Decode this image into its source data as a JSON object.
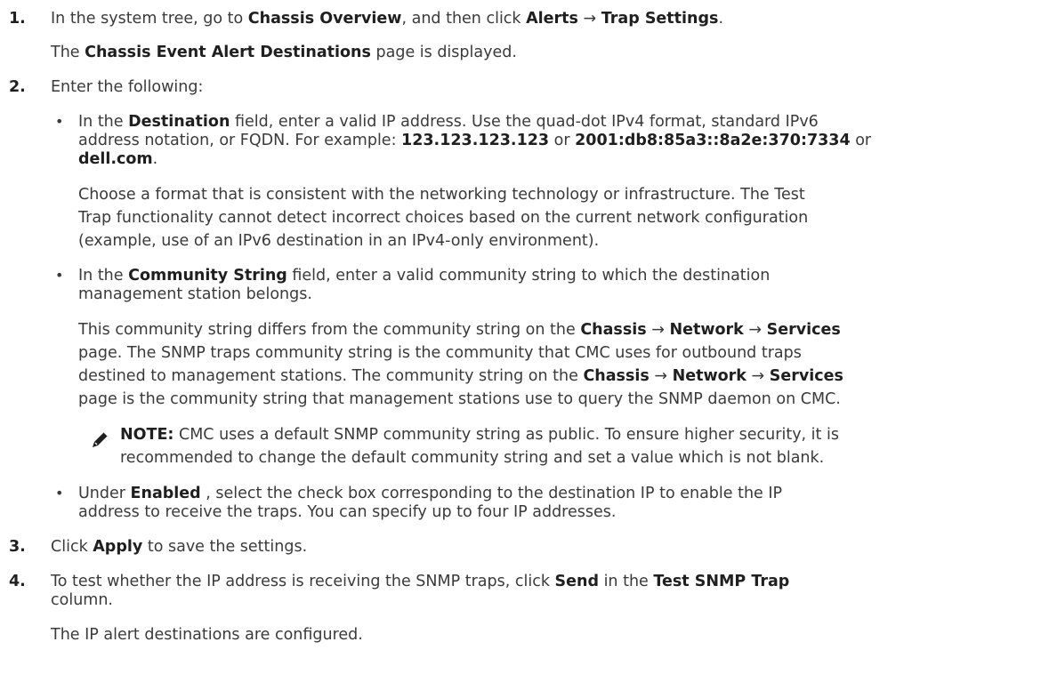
{
  "step1": {
    "num": "1.",
    "l1_a": "In the system tree, go to ",
    "l1_b": "Chassis Overview",
    "l1_c": ", and then click ",
    "l1_d": "Alerts",
    "l1_e": " → ",
    "l1_f": "Trap Settings",
    "l1_g": ".",
    "l2_a": "The ",
    "l2_b": "Chassis Event Alert Destinations",
    "l2_c": " page is displayed."
  },
  "step2": {
    "num": "2.",
    "intro": "Enter the following:",
    "dest": {
      "l1_a": "In the ",
      "l1_b": "Destination",
      "l1_c": " field, enter a valid IP address. Use the quad-dot IPv4 format, standard IPv6",
      "l2_a": "address notation, or FQDN. For example: ",
      "l2_b": "123.123.123.123",
      "l2_c": " or ",
      "l2_d": "2001:db8:85a3::8a2e:370:7334",
      "l2_e": " or",
      "l3_a": "dell.com",
      "l3_b": ".",
      "p1": "Choose a format that is consistent with the networking technology or infrastructure. The Test",
      "p2": "Trap functionality cannot detect incorrect choices based on the current network configuration",
      "p3": "(example, use of an IPv6 destination in an IPv4-only environment)."
    },
    "community": {
      "l1_a": "In the ",
      "l1_b": "Community String",
      "l1_c": " field, enter a valid community string to which the destination",
      "l2": "management station belongs.",
      "p1_a": "This community string differs from the community string on the ",
      "p1_b": "Chassis",
      "p1_c": " → ",
      "p1_d": "Network",
      "p1_e": " → ",
      "p1_f": "Services",
      "p2": "page. The SNMP traps community string is the community that CMC uses for outbound traps",
      "p3_a": "destined to management stations. The community string on the ",
      "p3_b": "Chassis",
      "p3_c": " → ",
      "p3_d": "Network",
      "p3_e": " → ",
      "p3_f": "Services",
      "p4": "page is the community string that management stations use to query the SNMP daemon on CMC."
    },
    "note": {
      "label": "NOTE:",
      "l1": " CMC uses a default SNMP community string as public. To ensure higher security, it is",
      "l2": "recommended to change the default community string and set a value which is not blank."
    },
    "enabled": {
      "l1_a": "Under ",
      "l1_b": "Enabled",
      "l1_c": " , select the check box corresponding to the destination IP to enable the IP",
      "l2": "address to receive the traps. You can specify up to four IP addresses."
    }
  },
  "step3": {
    "num": "3.",
    "a": "Click ",
    "b": "Apply",
    "c": " to save the settings."
  },
  "step4": {
    "num": "4.",
    "l1_a": "To test whether the IP address is receiving the SNMP traps, click ",
    "l1_b": "Send",
    "l1_c": " in the ",
    "l1_d": "Test SNMP Trap",
    "l2": "column."
  },
  "result": "The IP alert destinations are configured.",
  "bullet": "•"
}
